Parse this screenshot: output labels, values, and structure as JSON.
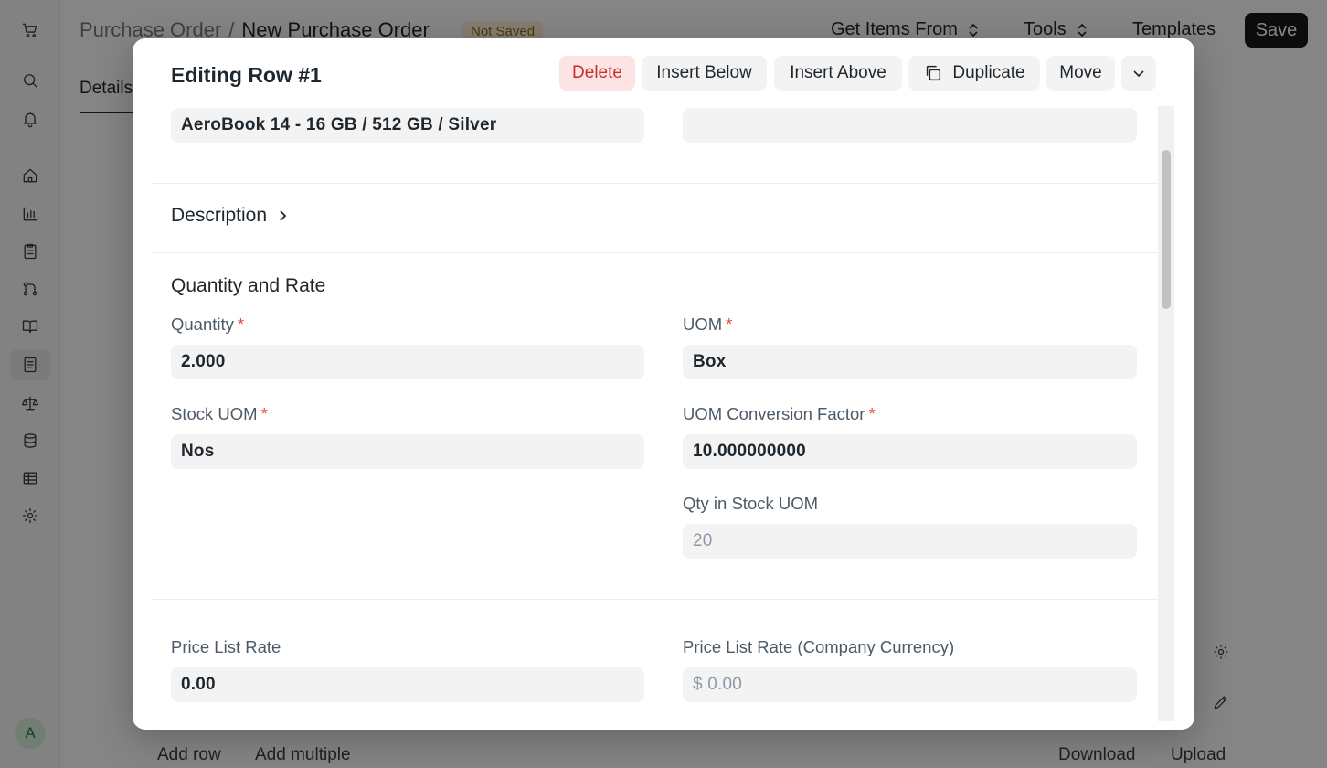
{
  "app": {
    "breadcrumb": {
      "parent": "Purchase Order",
      "separator": "/",
      "current": "New Purchase Order"
    },
    "status_badge": "Not Saved",
    "toolbar": {
      "get_items_from": "Get Items From",
      "tools": "Tools",
      "templates": "Templates",
      "save": "Save"
    },
    "tab": "Details",
    "table_actions": {
      "add_row": "Add row",
      "add_multiple": "Add multiple",
      "download": "Download",
      "upload": "Upload"
    },
    "avatar_letter": "A"
  },
  "modal": {
    "title": "Editing Row #1",
    "actions": {
      "delete": "Delete",
      "insert_below": "Insert Below",
      "insert_above": "Insert Above",
      "duplicate": "Duplicate",
      "move": "Move"
    },
    "item_name": "AeroBook 14 - 16 GB / 512 GB / Silver",
    "description_label": "Description",
    "section_qty_rate": "Quantity and Rate",
    "fields": {
      "quantity": {
        "label": "Quantity",
        "value": "2.000"
      },
      "uom": {
        "label": "UOM",
        "value": "Box"
      },
      "stock_uom": {
        "label": "Stock UOM",
        "value": "Nos"
      },
      "uom_conversion_factor": {
        "label": "UOM Conversion Factor",
        "value": "10.000000000"
      },
      "qty_in_stock_uom": {
        "label": "Qty in Stock UOM",
        "value": "20"
      },
      "price_list_rate": {
        "label": "Price List Rate",
        "value": "0.00"
      },
      "price_list_rate_company": {
        "label": "Price List Rate (Company Currency)",
        "value": "$ 0.00"
      }
    },
    "required_marker": "*"
  },
  "colors": {
    "danger": "#c4302b",
    "danger_bg": "#fde4e4",
    "save_bg": "#171717",
    "badge_bg": "#fdf2d8"
  }
}
